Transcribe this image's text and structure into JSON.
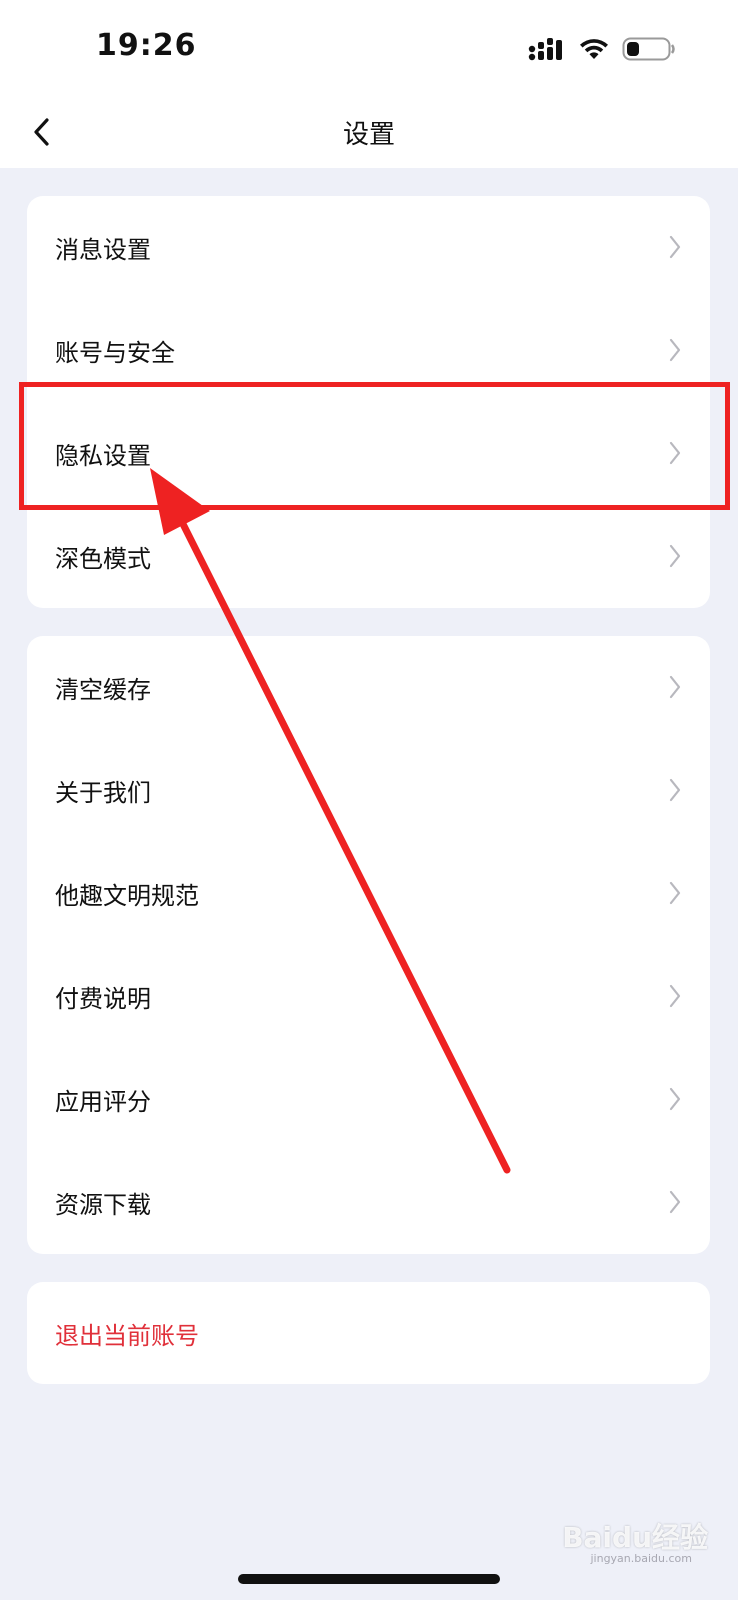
{
  "status_bar": {
    "time": "19:26"
  },
  "nav": {
    "title": "设置"
  },
  "group1": {
    "items": [
      {
        "label": "消息设置"
      },
      {
        "label": "账号与安全"
      },
      {
        "label": "隐私设置"
      },
      {
        "label": "深色模式"
      }
    ]
  },
  "group2": {
    "items": [
      {
        "label": "清空缓存"
      },
      {
        "label": "关于我们"
      },
      {
        "label": "他趣文明规范"
      },
      {
        "label": "付费说明"
      },
      {
        "label": "应用评分"
      },
      {
        "label": "资源下载"
      }
    ]
  },
  "logout": {
    "label": "退出当前账号"
  },
  "watermark": {
    "brand": "Baidu经验",
    "url": "jingyan.baidu.com"
  },
  "colors": {
    "background": "#EEF0F8",
    "card": "#FFFFFF",
    "logout_text": "#E0303A",
    "annotation_red": "#EE2222"
  },
  "icons": {
    "back": "chevron-left-icon",
    "row": "chevron-right-icon",
    "signal": "cellular-signal-icon",
    "wifi": "wifi-icon",
    "battery": "battery-icon"
  }
}
